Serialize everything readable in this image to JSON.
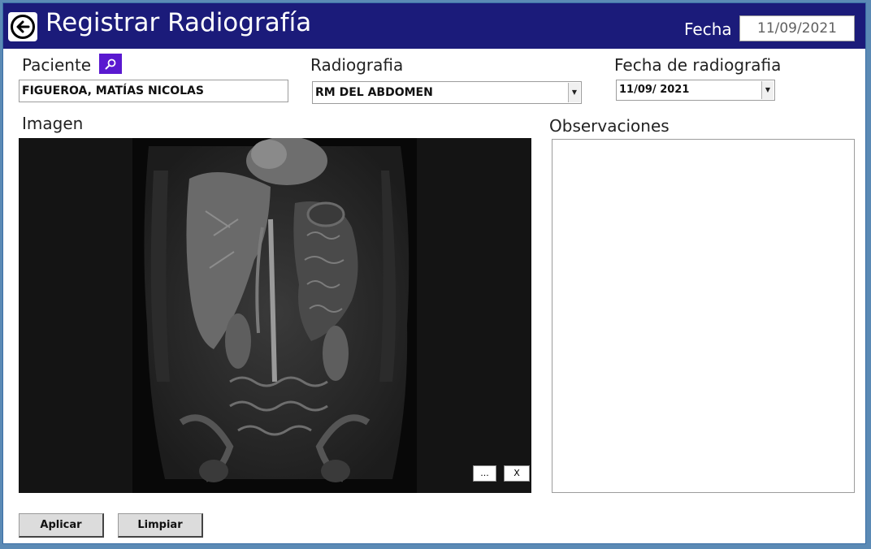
{
  "header": {
    "title": "Registrar Radiografía",
    "fecha_label": "Fecha",
    "fecha_value": "11/09/2021"
  },
  "paciente": {
    "label": "Paciente",
    "value": "FIGUEROA, MATÍAS NICOLAS"
  },
  "radiografia": {
    "label": "Radiografia",
    "selected": "RM DEL ABDOMEN"
  },
  "fecha_radiografia": {
    "label": "Fecha de radiografia",
    "value": "11/09/ 2021"
  },
  "imagen": {
    "label": "Imagen",
    "browse_label": "...",
    "clear_label": "X"
  },
  "observaciones": {
    "label": "Observaciones",
    "value": ""
  },
  "actions": {
    "apply_label": "Aplicar",
    "clear_label": "Limpiar"
  },
  "colors": {
    "titlebar": "#1b1b7a",
    "search_button": "#5a19d0"
  },
  "icons": [
    "back-arrow-icon",
    "search-icon",
    "dropdown-arrow-icon"
  ]
}
